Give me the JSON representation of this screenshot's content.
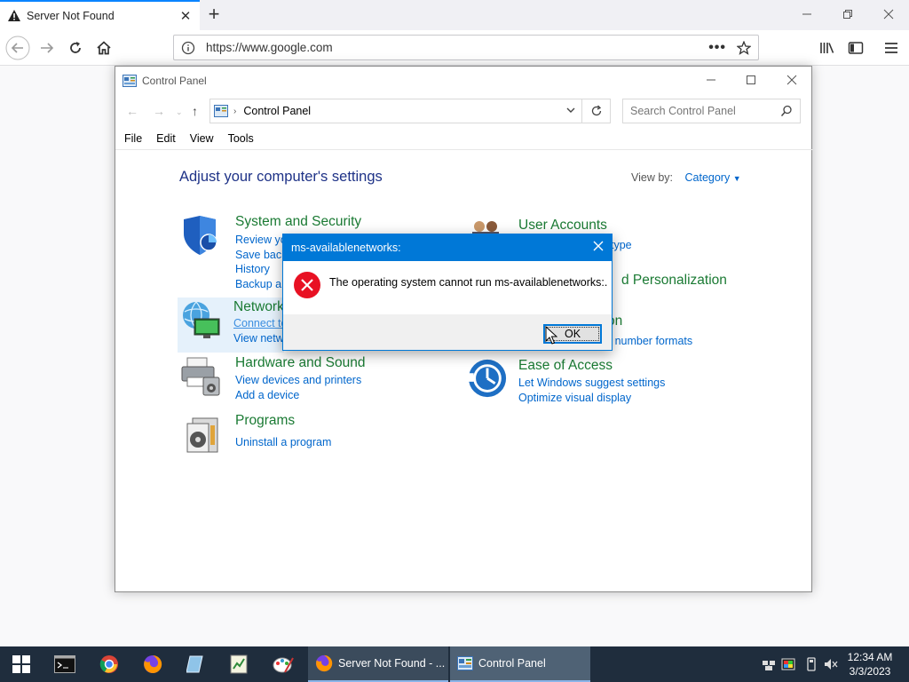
{
  "browser": {
    "tab_title": "Server Not Found",
    "url": "https://www.google.com"
  },
  "control_panel": {
    "window_title": "Control Panel",
    "breadcrumb": "Control Panel",
    "search_placeholder": "Search Control Panel",
    "menu": [
      "File",
      "Edit",
      "View",
      "Tools"
    ],
    "heading": "Adjust your computer's settings",
    "view_by_label": "View by:",
    "view_by_value": "Category",
    "categories": {
      "system": {
        "name": "System and Security",
        "links": [
          "Review yo",
          "Save backu",
          "History",
          "Backup an"
        ]
      },
      "network": {
        "name": "Network",
        "links": [
          "Connect to",
          "View netw"
        ]
      },
      "hardware": {
        "name": "Hardware and Sound",
        "links": [
          "View devices and printers",
          "Add a device"
        ]
      },
      "programs": {
        "name": "Programs",
        "links": [
          "Uninstall a program"
        ]
      },
      "users": {
        "name": "User Accounts",
        "links": [
          "type"
        ]
      },
      "appearance": {
        "name": "d Personalization",
        "links": []
      },
      "clock": {
        "name": "on",
        "links": [
          "or number formats"
        ]
      },
      "ease": {
        "name": "Ease of Access",
        "links": [
          "Let Windows suggest settings",
          "Optimize visual display"
        ]
      }
    }
  },
  "dialog": {
    "title": "ms-availablenetworks:",
    "message": "The operating system cannot run ms-availablenetworks:.",
    "ok_label": "OK"
  },
  "taskbar": {
    "firefox_task": "Server Not Found - ...",
    "cp_task": "Control Panel",
    "time": "12:34 AM",
    "date": "3/3/2023"
  },
  "colors": {
    "accent": "#0078d7",
    "link": "#0066cc",
    "category_green": "#1a7a33",
    "heading_blue": "#1e3287",
    "taskbar": "#1f2d3d"
  }
}
